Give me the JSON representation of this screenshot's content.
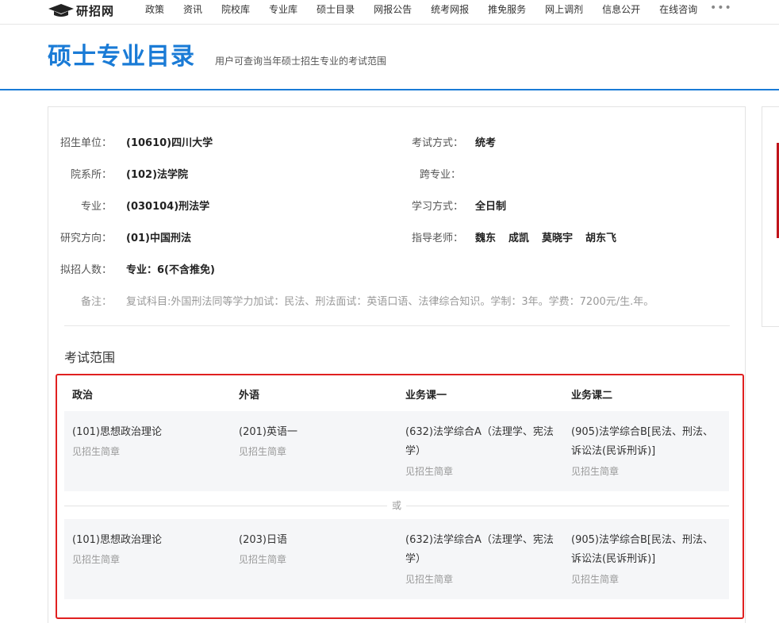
{
  "nav": {
    "logo_text": "研招网",
    "items": [
      "政策",
      "资讯",
      "院校库",
      "专业库",
      "硕士目录",
      "网报公告",
      "统考网报",
      "推免服务",
      "网上调剂",
      "信息公开",
      "在线咨询"
    ],
    "more": "•••"
  },
  "header": {
    "title": "硕士专业目录",
    "subtitle": "用户可查询当年硕士招生专业的考试范围"
  },
  "info": {
    "unit_label": "招生单位：",
    "unit_value": "(10610)四川大学",
    "dept_label": "院系所：",
    "dept_value": "(102)法学院",
    "major_label": "专业：",
    "major_value": "(030104)刑法学",
    "direction_label": "研究方向：",
    "direction_value": "(01)中国刑法",
    "quota_label": "拟招人数：",
    "quota_value": "专业：6(不含推免)",
    "remark_label": "备注：",
    "remark_value": "复试科目:外国刑法同等学力加试：民法、刑法面试：英语口语、法律综合知识。学制：3年。学费：7200元/生.年。",
    "exam_mode_label": "考试方式：",
    "exam_mode_value": "统考",
    "cross_label": "跨专业：",
    "cross_value": "",
    "study_mode_label": "学习方式：",
    "study_mode_value": "全日制",
    "advisor_label": "指导老师：",
    "advisors": [
      "魏东",
      "成凯",
      "莫晓宇",
      "胡东飞"
    ]
  },
  "scope": {
    "title": "考试范围",
    "columns": [
      "政治",
      "外语",
      "业务课一",
      "业务课二"
    ],
    "or_text": "或",
    "options": [
      {
        "subjects": [
          {
            "name": "(101)思想政治理论",
            "note": "见招生简章"
          },
          {
            "name": "(201)英语一",
            "note": "见招生简章"
          },
          {
            "name": "(632)法学综合A（法理学、宪法学）",
            "note": "见招生简章"
          },
          {
            "name": "(905)法学综合B[民法、刑法、诉讼法(民诉刑诉)]",
            "note": "见招生简章"
          }
        ]
      },
      {
        "subjects": [
          {
            "name": "(101)思想政治理论",
            "note": "见招生简章"
          },
          {
            "name": "(203)日语",
            "note": "见招生简章"
          },
          {
            "name": "(632)法学综合A（法理学、宪法学）",
            "note": "见招生简章"
          },
          {
            "name": "(905)法学综合B[民法、刑法、诉讼法(民诉刑诉)]",
            "note": "见招生简章"
          }
        ]
      }
    ]
  }
}
